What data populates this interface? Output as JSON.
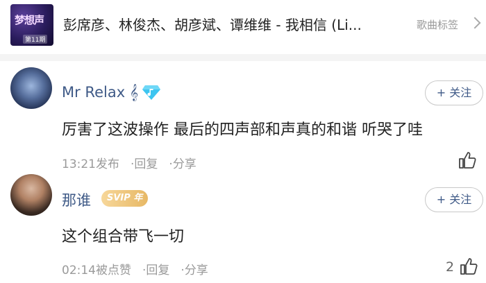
{
  "song": {
    "cover_title": "梦想声",
    "cover_badge": "第11期",
    "title": "彭席彦、林俊杰、胡彦斌、谭维维 - 我相信 (Li...",
    "tag_label": "歌曲标签"
  },
  "comments": [
    {
      "username": "Mr Relax 𝄞",
      "follow_label": "+ 关注",
      "text": "厉害了这波操作 最后的四声部和声真的和谐 听哭了哇",
      "time": "13:21发布",
      "reply_label": "回复",
      "share_label": "分享",
      "like_count": ""
    },
    {
      "username": "那谁",
      "badge": "SVIP 年",
      "follow_label": "+ 关注",
      "text": "这个组合带飞一切",
      "time": "02:14被点赞",
      "reply_label": "回复",
      "share_label": "分享",
      "like_count": "2"
    }
  ],
  "colors": {
    "username": "#3f5a87",
    "meta": "#9a9a9a",
    "svip_gold": "#e7b865",
    "diamond": "#3dc5f0"
  }
}
